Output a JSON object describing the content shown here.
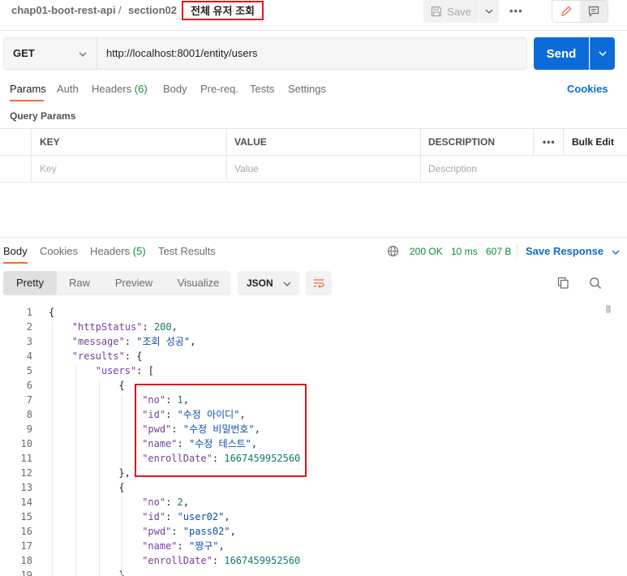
{
  "breadcrumb": {
    "collection": "chap01-boot-rest-api",
    "separator": "/",
    "folder": "section02",
    "request_name": "전체 유저 조회"
  },
  "toolbar": {
    "save_label": "Save",
    "more_label": "•••"
  },
  "request": {
    "method": "GET",
    "url": "http://localhost:8001/entity/users",
    "send_label": "Send"
  },
  "request_tabs": [
    {
      "label": "Params",
      "count": ""
    },
    {
      "label": "Auth",
      "count": ""
    },
    {
      "label": "Headers",
      "count": "(6)"
    },
    {
      "label": "Body",
      "count": ""
    },
    {
      "label": "Pre-req.",
      "count": ""
    },
    {
      "label": "Tests",
      "count": ""
    },
    {
      "label": "Settings",
      "count": ""
    }
  ],
  "cookies_label": "Cookies",
  "query_params": {
    "title": "Query Params",
    "columns": [
      "KEY",
      "VALUE",
      "DESCRIPTION"
    ],
    "more_label": "•••",
    "bulk_edit_label": "Bulk Edit",
    "placeholders": [
      "Key",
      "Value",
      "Description"
    ]
  },
  "response_tabs": [
    {
      "label": "Body",
      "count": ""
    },
    {
      "label": "Cookies",
      "count": ""
    },
    {
      "label": "Headers",
      "count": "(5)"
    },
    {
      "label": "Test Results",
      "count": ""
    }
  ],
  "response_status": {
    "status": "200 OK",
    "time": "10 ms",
    "size": "607 B",
    "save_response_label": "Save Response"
  },
  "view_modes": [
    "Pretty",
    "Raw",
    "Preview",
    "Visualize"
  ],
  "format": "JSON",
  "code_lines": [
    {
      "n": "1",
      "indent": 0,
      "parts": [
        [
          "p",
          "{"
        ]
      ]
    },
    {
      "n": "2",
      "indent": 1,
      "parts": [
        [
          "k",
          "\"httpStatus\""
        ],
        [
          "p",
          ": "
        ],
        [
          "num",
          "200"
        ],
        [
          "p",
          ","
        ]
      ]
    },
    {
      "n": "3",
      "indent": 1,
      "parts": [
        [
          "k",
          "\"message\""
        ],
        [
          "p",
          ": "
        ],
        [
          "s",
          "\"조회 성공\""
        ],
        [
          "p",
          ","
        ]
      ]
    },
    {
      "n": "4",
      "indent": 1,
      "parts": [
        [
          "k",
          "\"results\""
        ],
        [
          "p",
          ": {"
        ]
      ]
    },
    {
      "n": "5",
      "indent": 2,
      "parts": [
        [
          "k",
          "\"users\""
        ],
        [
          "p",
          ": ["
        ]
      ]
    },
    {
      "n": "6",
      "indent": 3,
      "parts": [
        [
          "p",
          "{"
        ]
      ]
    },
    {
      "n": "7",
      "indent": 4,
      "parts": [
        [
          "k",
          "\"no\""
        ],
        [
          "p",
          ": "
        ],
        [
          "num",
          "1"
        ],
        [
          "p",
          ","
        ]
      ]
    },
    {
      "n": "8",
      "indent": 4,
      "parts": [
        [
          "k",
          "\"id\""
        ],
        [
          "p",
          ": "
        ],
        [
          "s",
          "\"수정 아이디\""
        ],
        [
          "p",
          ","
        ]
      ]
    },
    {
      "n": "9",
      "indent": 4,
      "parts": [
        [
          "k",
          "\"pwd\""
        ],
        [
          "p",
          ": "
        ],
        [
          "s",
          "\"수정 비밀번호\""
        ],
        [
          "p",
          ","
        ]
      ]
    },
    {
      "n": "10",
      "indent": 4,
      "parts": [
        [
          "k",
          "\"name\""
        ],
        [
          "p",
          ": "
        ],
        [
          "s",
          "\"수정 테스트\""
        ],
        [
          "p",
          ","
        ]
      ]
    },
    {
      "n": "11",
      "indent": 4,
      "parts": [
        [
          "k",
          "\"enrollDate\""
        ],
        [
          "p",
          ": "
        ],
        [
          "num",
          "1667459952560"
        ]
      ]
    },
    {
      "n": "12",
      "indent": 3,
      "parts": [
        [
          "p",
          "},"
        ]
      ]
    },
    {
      "n": "13",
      "indent": 3,
      "parts": [
        [
          "p",
          "{"
        ]
      ]
    },
    {
      "n": "14",
      "indent": 4,
      "parts": [
        [
          "k",
          "\"no\""
        ],
        [
          "p",
          ": "
        ],
        [
          "num",
          "2"
        ],
        [
          "p",
          ","
        ]
      ]
    },
    {
      "n": "15",
      "indent": 4,
      "parts": [
        [
          "k",
          "\"id\""
        ],
        [
          "p",
          ": "
        ],
        [
          "s",
          "\"user02\""
        ],
        [
          "p",
          ","
        ]
      ]
    },
    {
      "n": "16",
      "indent": 4,
      "parts": [
        [
          "k",
          "\"pwd\""
        ],
        [
          "p",
          ": "
        ],
        [
          "s",
          "\"pass02\""
        ],
        [
          "p",
          ","
        ]
      ]
    },
    {
      "n": "17",
      "indent": 4,
      "parts": [
        [
          "k",
          "\"name\""
        ],
        [
          "p",
          ": "
        ],
        [
          "s",
          "\"짱구\""
        ],
        [
          "p",
          ","
        ]
      ]
    },
    {
      "n": "18",
      "indent": 4,
      "parts": [
        [
          "k",
          "\"enrollDate\""
        ],
        [
          "p",
          ": "
        ],
        [
          "num",
          "1667459952560"
        ]
      ]
    },
    {
      "n": "19",
      "indent": 3,
      "parts": [
        [
          "p",
          "}"
        ]
      ]
    }
  ],
  "colors": {
    "accent_blue": "#0c6bd8",
    "tab_underline": "#f26b3a",
    "status_green": "#0f8a38",
    "highlight_red": "#e8131a"
  },
  "icons": {
    "save": "floppy-disk-icon",
    "edit": "pencil-icon",
    "comments": "comment-icon",
    "globe": "globe-icon",
    "copy": "copy-icon",
    "search": "search-icon",
    "wrap": "wrap-lines-icon"
  }
}
